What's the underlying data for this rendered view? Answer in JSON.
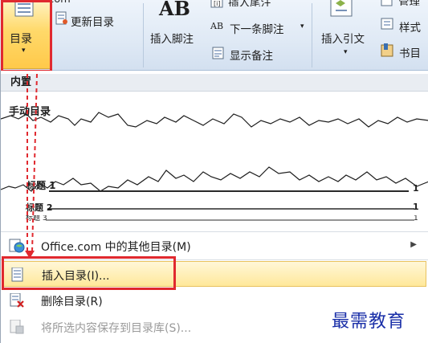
{
  "watermark": "Office.com",
  "ribbon": {
    "toc_button": {
      "label": "目录",
      "arrow": "▾"
    },
    "update_toc": "更新目录",
    "footnote_icon_text": "AB",
    "insert_footnote": "插入脚注",
    "insert_endnote": "插入尾注",
    "next_footnote": "下一条脚注",
    "next_footnote_marker": "AB",
    "show_notes": "显示备注",
    "insert_citation": "插入引文",
    "style": "样式",
    "bibliography": "书目",
    "manage_sources_partial": "管理"
  },
  "dropdown": {
    "section_builtin": "内置",
    "manual_toc_title": "手动目录",
    "preview": {
      "heading1": "标题 1",
      "heading2": "标题 2",
      "heading3": "标题 3",
      "page1": "1",
      "page2": "1",
      "page3": "1"
    },
    "menu": [
      {
        "label": "Office.com 中的其他目录(M)",
        "has_submenu": true,
        "icon": "office-globe-icon"
      },
      {
        "label": "插入目录(I)...",
        "highlighted": true,
        "icon": "document-toc-icon"
      },
      {
        "label": "删除目录(R)",
        "icon": "delete-toc-icon"
      },
      {
        "label": "将所选内容保存到目录库(S)...",
        "disabled": true,
        "icon": "save-selection-icon"
      }
    ]
  },
  "brand": "最需教育",
  "colors": {
    "highlight_red": "#e0292f",
    "ribbon_bg": "#dfe9f5",
    "selected_item": "#ffe89a",
    "brand_blue": "#1a2fa8"
  }
}
